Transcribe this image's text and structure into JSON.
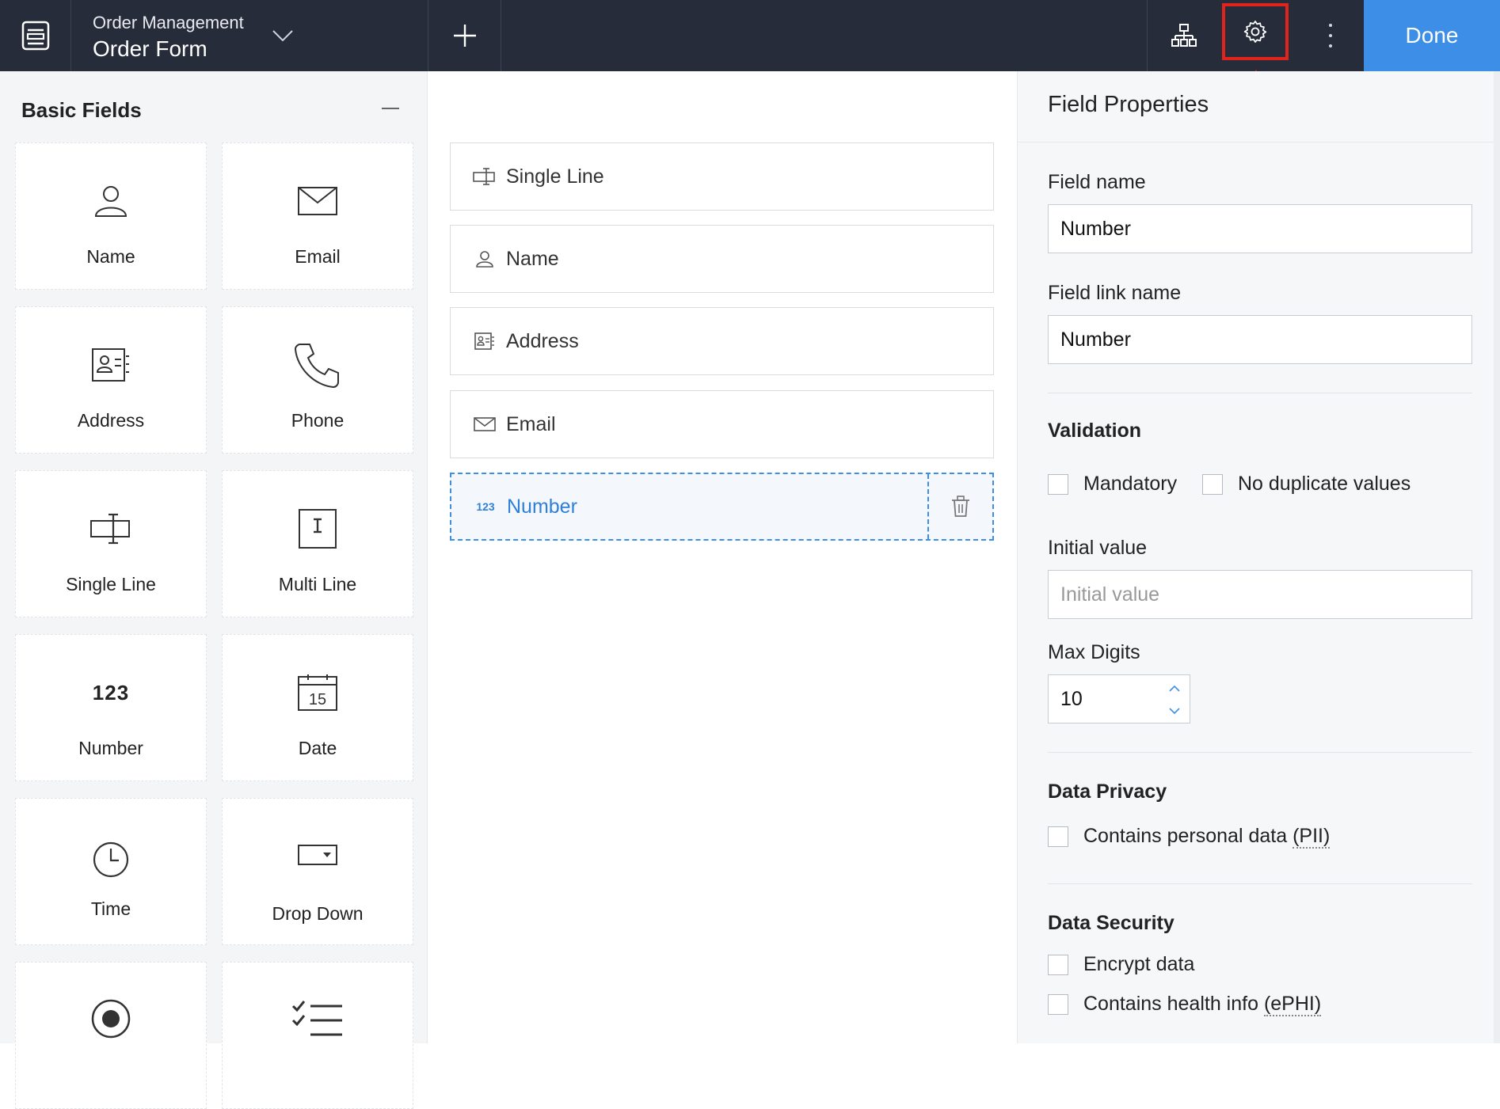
{
  "topbar": {
    "app_name": "Order Management",
    "form_name": "Order Form",
    "done_label": "Done"
  },
  "left_panel": {
    "title": "Basic Fields",
    "tiles": [
      {
        "label": "Name",
        "icon": "person-icon"
      },
      {
        "label": "Email",
        "icon": "envelope-icon"
      },
      {
        "label": "Address",
        "icon": "address-card-icon"
      },
      {
        "label": "Phone",
        "icon": "phone-icon"
      },
      {
        "label": "Single Line",
        "icon": "single-line-icon"
      },
      {
        "label": "Multi Line",
        "icon": "multi-line-icon"
      },
      {
        "label": "Number",
        "icon": "number-icon",
        "glyph": "123"
      },
      {
        "label": "Date",
        "icon": "calendar-icon",
        "glyph": "15"
      },
      {
        "label": "Time",
        "icon": "clock-icon"
      },
      {
        "label": "Drop Down",
        "icon": "dropdown-icon"
      },
      {
        "label": "",
        "icon": "radio-icon"
      },
      {
        "label": "",
        "icon": "checklist-icon"
      }
    ]
  },
  "canvas": {
    "fields": [
      {
        "label": "Single Line",
        "icon": "single-line-icon"
      },
      {
        "label": "Name",
        "icon": "person-icon"
      },
      {
        "label": "Address",
        "icon": "address-card-icon"
      },
      {
        "label": "Email",
        "icon": "envelope-icon"
      },
      {
        "label": "Number",
        "icon": "number-icon",
        "glyph": "123",
        "selected": true
      }
    ]
  },
  "properties": {
    "title": "Field Properties",
    "field_name_label": "Field name",
    "field_name_value": "Number",
    "field_link_label": "Field link name",
    "field_link_value": "Number",
    "validation_title": "Validation",
    "mandatory_label": "Mandatory",
    "no_duplicate_label": "No duplicate values",
    "initial_value_label": "Initial value",
    "initial_value_placeholder": "Initial value",
    "max_digits_label": "Max Digits",
    "max_digits_value": "10",
    "privacy_title": "Data Privacy",
    "pii_label": "Contains personal data",
    "pii_abbr": "(PII)",
    "security_title": "Data Security",
    "encrypt_label": "Encrypt data",
    "health_label": "Contains health info",
    "health_abbr": "(ePHI)"
  },
  "colors": {
    "topbar_bg": "#272c3b",
    "accent": "#3d8ee6",
    "highlight": "#e0241b"
  }
}
